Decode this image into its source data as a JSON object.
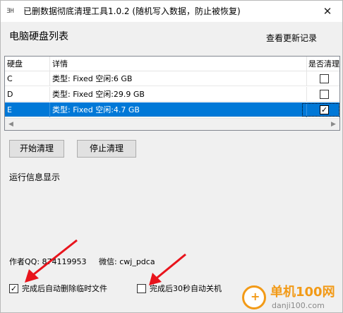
{
  "window": {
    "title": "已删数据彻底清理工具1.0.2 (随机写入数据，防止被恢复)",
    "icon": "app-icon",
    "close_glyph": "✕"
  },
  "panel": {
    "title": "电脑硬盘列表",
    "changelog_label": "查看更新记录"
  },
  "table": {
    "columns": [
      "硬盘",
      "详情",
      "是否清理"
    ],
    "rows": [
      {
        "disk": "C",
        "detail": "类型: Fixed 空闲:6 GB",
        "checked": false,
        "selected": false
      },
      {
        "disk": "D",
        "detail": "类型: Fixed 空闲:29.9 GB",
        "checked": false,
        "selected": false
      },
      {
        "disk": "E",
        "detail": "类型: Fixed 空闲:4.7 GB",
        "checked": true,
        "selected": true
      }
    ]
  },
  "buttons": {
    "start": "开始清理",
    "stop": "停止清理"
  },
  "run_info": {
    "label": "运行信息显示"
  },
  "author": {
    "qq": "作者QQ: 874119953",
    "wechat": "微信: cwj_pdca"
  },
  "options": {
    "delete_temp": {
      "label": "完成后自动删除临时文件",
      "checked": true
    },
    "shutdown": {
      "label": "完成后30秒自动关机",
      "checked": false
    }
  },
  "watermark": {
    "title": "单机100网",
    "url": "danji100.com"
  },
  "colors": {
    "selection": "#0078d7",
    "arrow": "#e8141c",
    "watermark": "#f29a17"
  }
}
